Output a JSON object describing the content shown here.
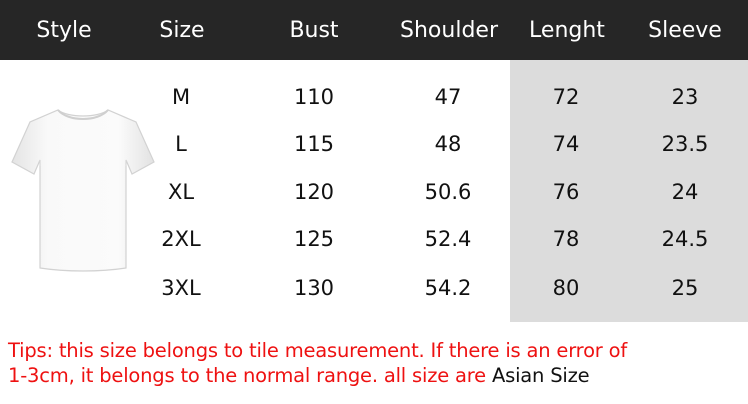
{
  "headers": [
    "Style",
    "Size",
    "Bust",
    "Shoulder",
    "Lenght",
    "Sleeve"
  ],
  "rows": [
    {
      "size": "M",
      "bust": "110",
      "shoulder": "47",
      "length": "72",
      "sleeve": "23"
    },
    {
      "size": "L",
      "bust": "115",
      "shoulder": "48",
      "length": "74",
      "sleeve": "23.5"
    },
    {
      "size": "XL",
      "bust": "120",
      "shoulder": "50.6",
      "length": "76",
      "sleeve": "24"
    },
    {
      "size": "2XL",
      "bust": "125",
      "shoulder": "52.4",
      "length": "78",
      "sleeve": "24.5"
    },
    {
      "size": "3XL",
      "bust": "130",
      "shoulder": "54.2",
      "length": "80",
      "sleeve": "25"
    }
  ],
  "tips": {
    "line1": "Tips: this size belongs to tile measurement. If there is an error of",
    "line2": "1-3cm, it belongs to the normal range. all size are ",
    "emphasis": "Asian Size"
  },
  "colors": {
    "header_bg": "#262626",
    "header_text": "#ffffff",
    "highlight_bg": "#dcdcdc",
    "tip_text": "#ee1111"
  },
  "icons": {
    "style_image": "white-tshirt-icon"
  }
}
